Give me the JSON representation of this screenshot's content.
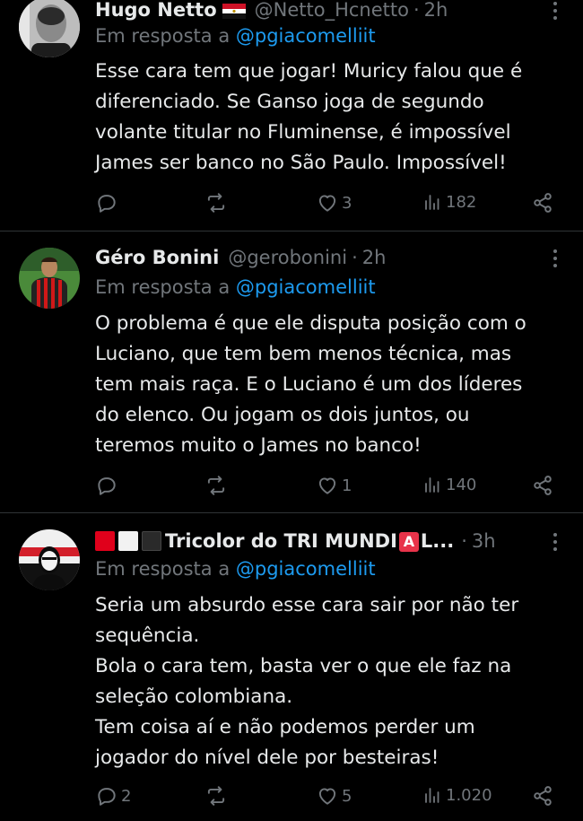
{
  "tweets": [
    {
      "name": "Hugo Netto",
      "handle": "@Netto_Hcnetto",
      "time": "2h",
      "reply_label": "Em resposta a",
      "reply_mention": "@pgiacomelliit",
      "lines": [
        "Esse cara tem que jogar! Muricy falou que é",
        "diferenciado. Se Ganso joga de segundo",
        "volante titular no Fluminense, é impossível",
        "James ser banco no São Paulo. Impossível!"
      ],
      "replies": "",
      "retweets": "",
      "likes": "3",
      "views": "182"
    },
    {
      "name": "Géro Bonini",
      "handle": "@gerobonini",
      "time": "2h",
      "reply_label": "Em resposta a",
      "reply_mention": "@pgiacomelliit",
      "lines": [
        "O problema é que ele disputa posição com o",
        "Luciano, que tem bem menos técnica, mas",
        "tem mais raça. E o Luciano é um dos líderes",
        "do elenco. Ou jogam os dois juntos, ou",
        "teremos muito o James no banco!"
      ],
      "replies": "",
      "retweets": "",
      "likes": "1",
      "views": "140"
    },
    {
      "name_before": "Tricolor do TRI MUNDI",
      "name_after": "L...",
      "name_emoji_letter": "A",
      "handle": "",
      "time": "3h",
      "reply_label": "Em resposta a",
      "reply_mention": "@pgiacomelliit",
      "lines": [
        "Seria um absurdo esse cara sair por não ter",
        "sequência.",
        "Bola o cara tem, basta ver o que ele faz na",
        "seleção colombiana.",
        "Tem coisa aí e não podemos perder um",
        "jogador do nível dele por besteiras!"
      ],
      "replies": "2",
      "retweets": "",
      "likes": "5",
      "views": "1.020"
    }
  ],
  "separator": "·",
  "icons": [
    "reply-icon",
    "retweet-icon",
    "like-icon",
    "views-icon",
    "share-icon",
    "more-icon"
  ],
  "colors": {
    "background": "#000000",
    "text": "#e7e9ea",
    "muted": "#71767b",
    "link": "#1d9bf0",
    "divider": "#2f3336"
  }
}
